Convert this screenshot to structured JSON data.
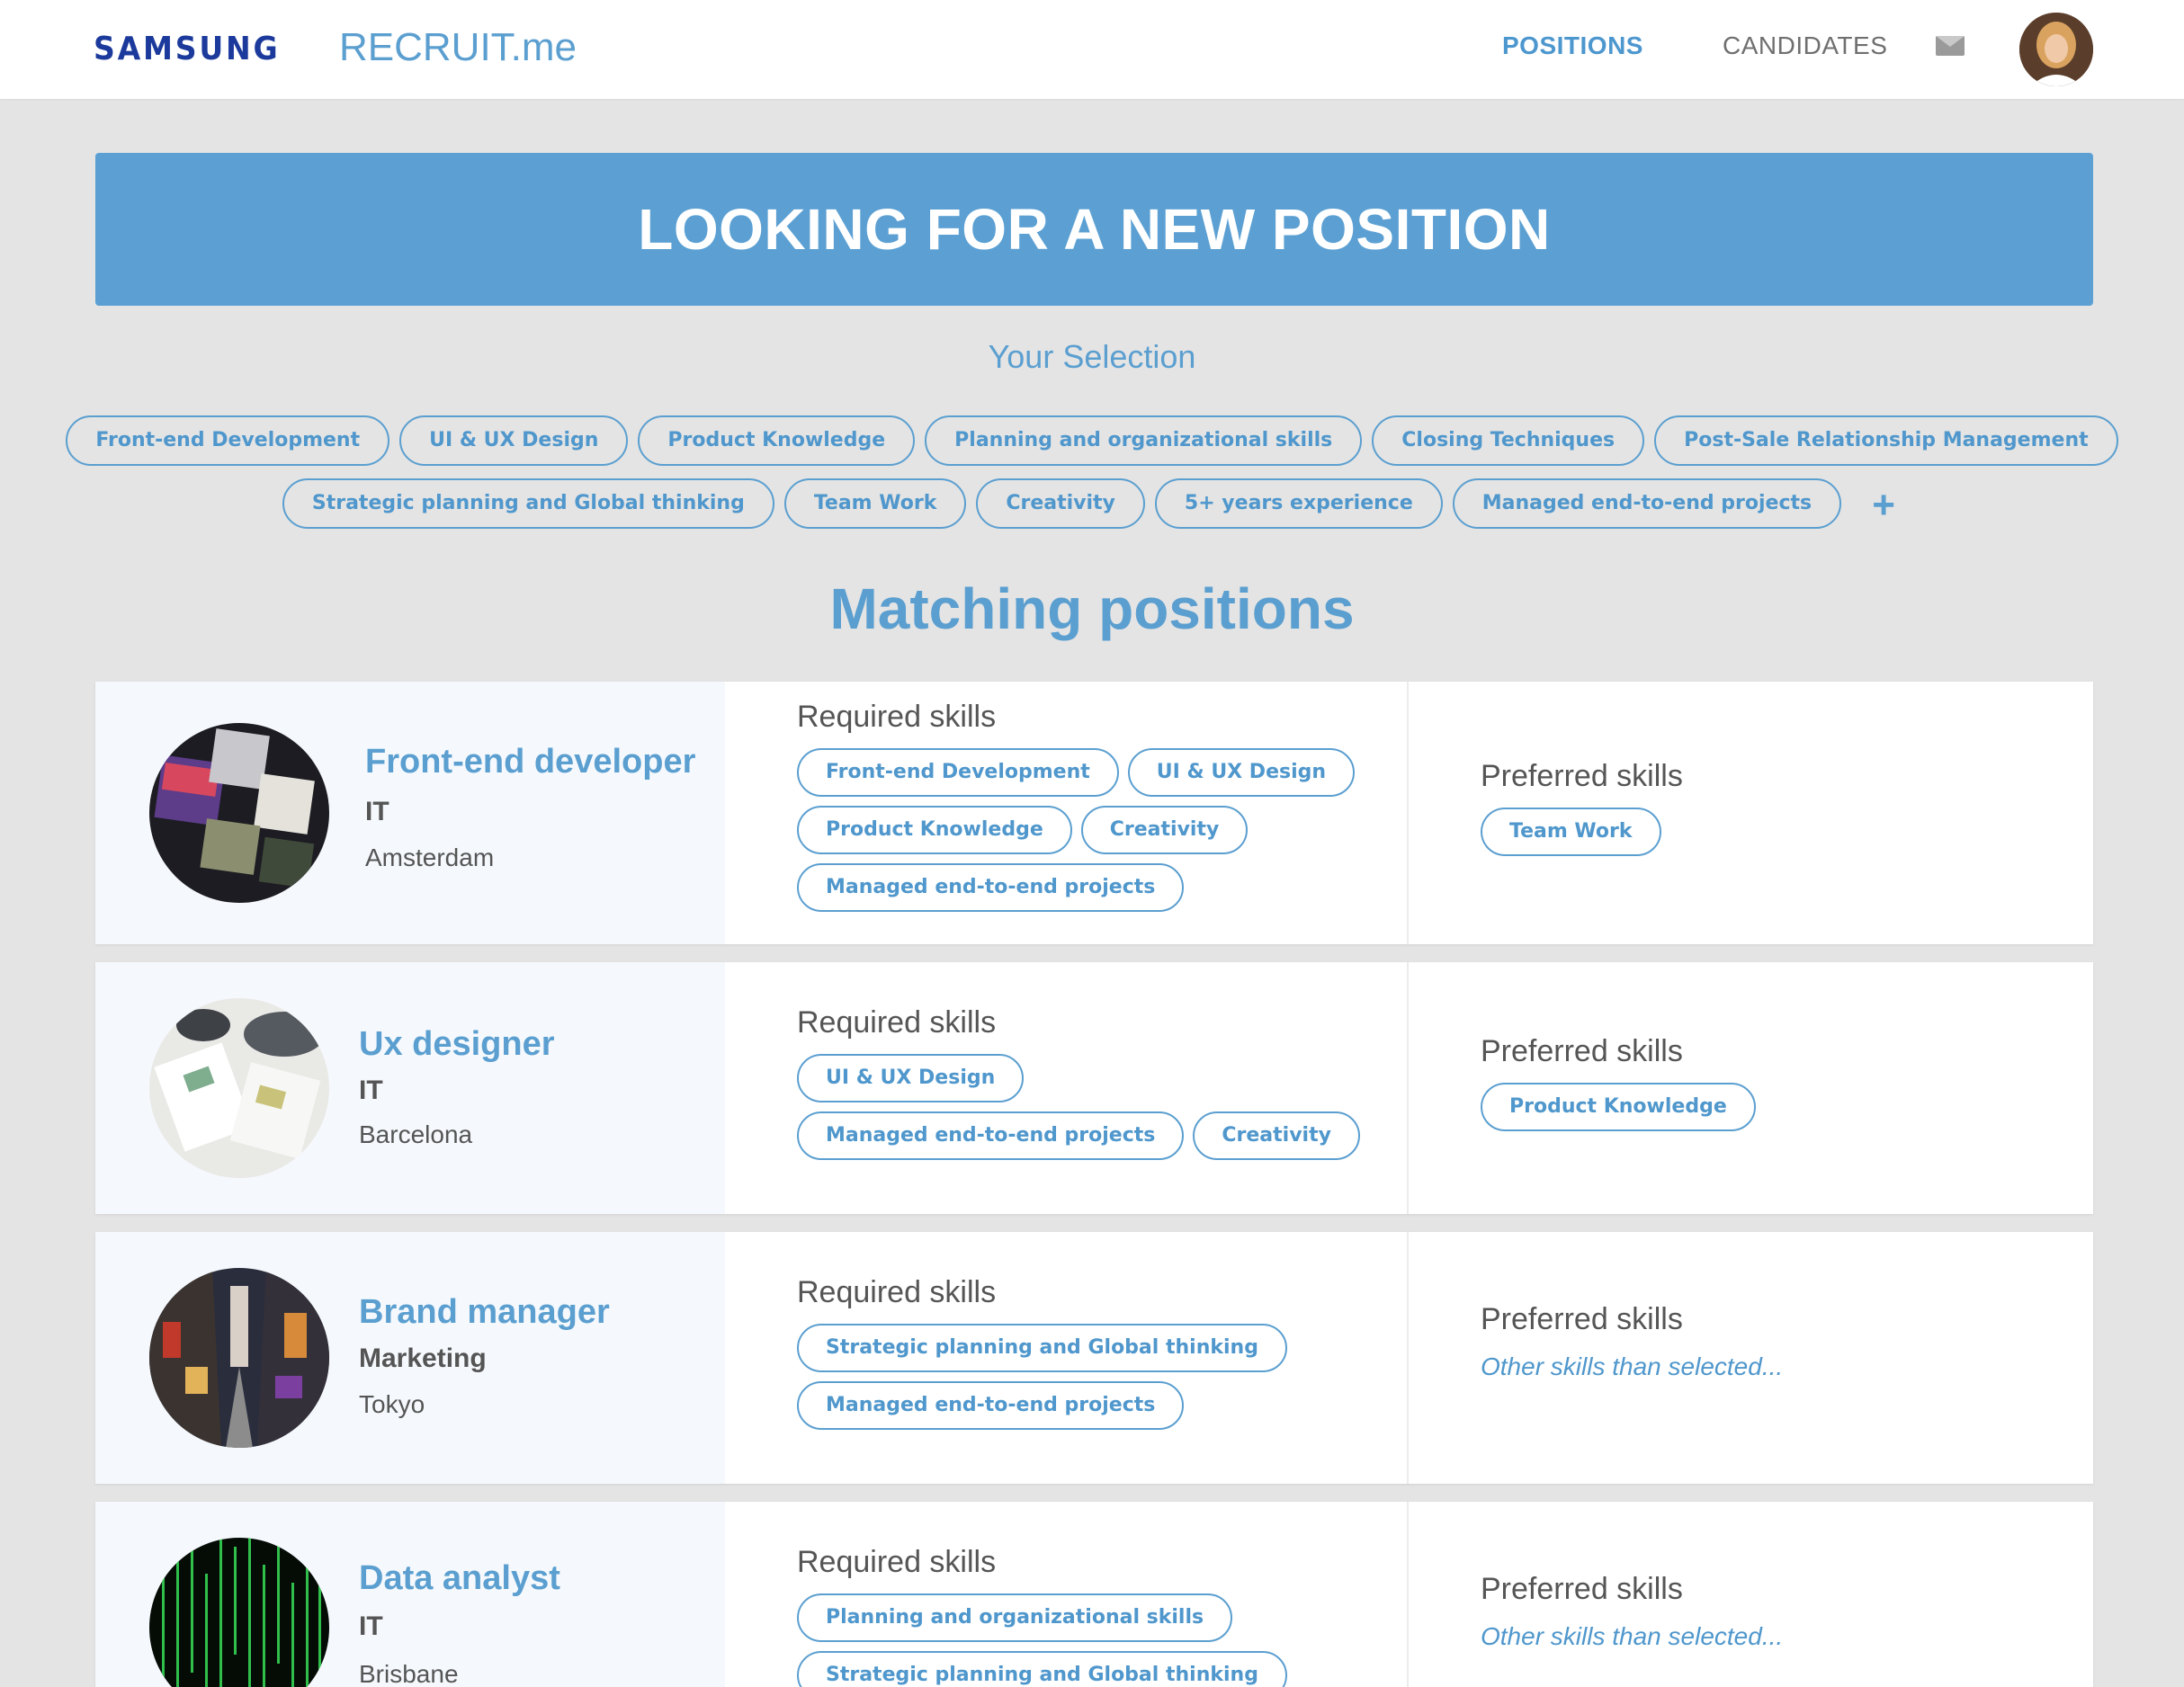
{
  "nav": {
    "brand": "SAMSUNG",
    "app_name": "RECRUIT.me",
    "positions": "POSITIONS",
    "candidates": "CANDIDATES",
    "mail_icon": "envelope-icon"
  },
  "hero": {
    "title": "LOOKING FOR A NEW POSITION"
  },
  "selection": {
    "title": "Your Selection",
    "row1": [
      "Front-end Development",
      "UI & UX Design",
      "Product Knowledge",
      "Planning and organizational skills",
      "Closing Techniques",
      "Post-Sale Relationship Management"
    ],
    "row2": [
      "Strategic planning and Global thinking",
      "Team Work",
      "Creativity",
      "5+ years experience",
      "Managed end-to-end projects"
    ],
    "add_label": "+"
  },
  "matching": {
    "title": "Matching positions"
  },
  "positions": [
    {
      "title": "Front-end developer",
      "department": "IT",
      "city": "Amsterdam",
      "required_label": "Required skills",
      "required": [
        "Front-end Development",
        "UI & UX Design",
        "Product Knowledge",
        "Creativity",
        "Managed end-to-end projects"
      ],
      "preferred_label": "Preferred skills",
      "preferred": [
        "Team Work"
      ],
      "preferred_placeholder": ""
    },
    {
      "title": "Ux designer",
      "department": "IT",
      "city": "Barcelona",
      "required_label": "Required skills",
      "required": [
        "UI & UX Design",
        "Managed end-to-end projects",
        "Creativity"
      ],
      "preferred_label": "Preferred skills",
      "preferred": [
        "Product Knowledge"
      ],
      "preferred_placeholder": ""
    },
    {
      "title": "Brand manager",
      "department": "Marketing",
      "city": "Tokyo",
      "required_label": "Required skills",
      "required": [
        "Strategic planning and Global thinking",
        "Managed end-to-end projects"
      ],
      "preferred_label": "Preferred skills",
      "preferred": [],
      "preferred_placeholder": "Other skills than selected..."
    },
    {
      "title": "Data analyst",
      "department": "IT",
      "city": "Brisbane",
      "required_label": "Required skills",
      "required": [
        "Planning and organizational skills",
        "Strategic planning and Global thinking"
      ],
      "preferred_label": "Preferred skills",
      "preferred": [],
      "preferred_placeholder": "Other skills than selected..."
    }
  ],
  "colors": {
    "accent": "#5b9fd0",
    "hero_bg": "#5ca0d3",
    "brand": "#1b3a9c",
    "page_bg": "#e4e4e4"
  }
}
